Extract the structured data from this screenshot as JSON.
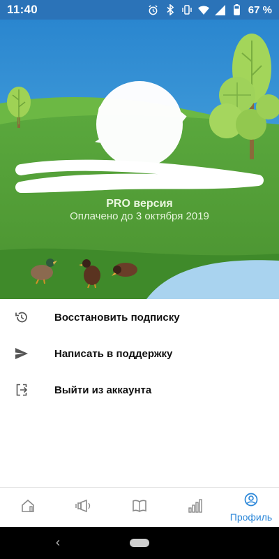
{
  "status_bar": {
    "time": "11:40",
    "battery_percent": "67 %",
    "icons": [
      "alarm-icon",
      "bluetooth-icon",
      "vibrate-icon",
      "wifi-icon",
      "signal-icon",
      "battery-icon"
    ]
  },
  "profile": {
    "plan": "PRO версия",
    "paid_until": "Оплачено до 3 октября 2019"
  },
  "menu": {
    "items": [
      {
        "label": "Восстановить подписку",
        "icon": "history-icon"
      },
      {
        "label": "Написать в поддержку",
        "icon": "send-icon"
      },
      {
        "label": "Выйти из аккаунта",
        "icon": "logout-icon"
      }
    ]
  },
  "bottom_nav": {
    "items": [
      {
        "icon": "home-icon",
        "label": ""
      },
      {
        "icon": "bird-sound-icon",
        "label": ""
      },
      {
        "icon": "book-icon",
        "label": ""
      },
      {
        "icon": "stats-icon",
        "label": ""
      },
      {
        "icon": "profile-icon",
        "label": "Профиль",
        "active": true
      }
    ]
  },
  "colors": {
    "status_bar": "#2b73b8",
    "sky": "#2f8fd0",
    "grass": "#4f9a35",
    "accent": "#2a86d8"
  }
}
